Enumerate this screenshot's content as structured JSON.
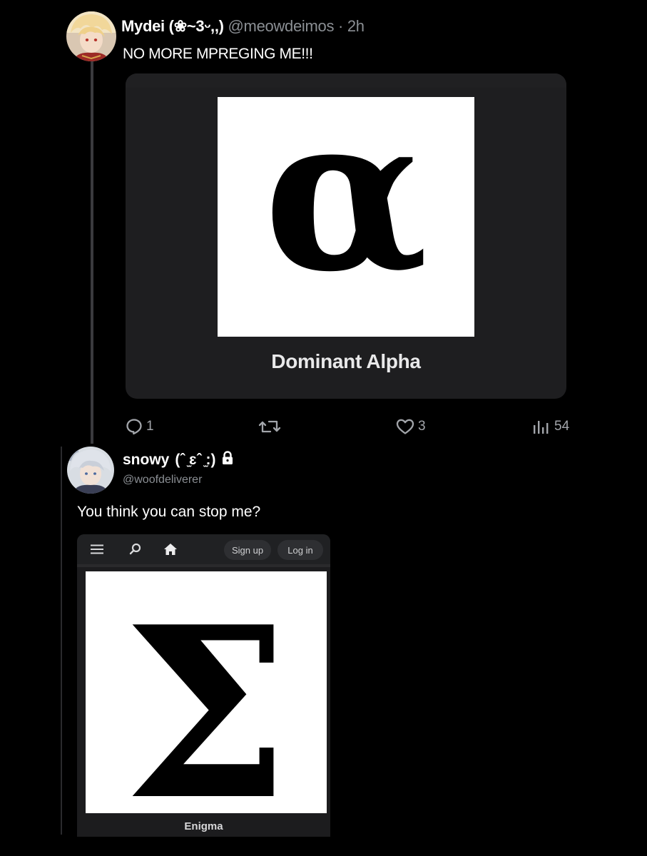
{
  "tweet": {
    "author_name": "Mydei",
    "author_kaomoji": "(❀~3ᵕ,,)",
    "author_handle": "@meowdeimos",
    "separator": "·",
    "time_ago": "2h",
    "text": "NO MORE MPREGING ME!!!",
    "card": {
      "symbol": "α",
      "caption": "Dominant Alpha"
    },
    "actions": {
      "replies": "1",
      "likes": "3",
      "views": "54"
    }
  },
  "reply": {
    "author_name": "snowy",
    "author_kaomoji": "(ˆ ̫ɛˆ ̫:)",
    "author_handle": "@woofdeliverer",
    "text": "You think you can stop me?",
    "card": {
      "nav": {
        "signup_label": "Sign up",
        "login_label": "Log in"
      },
      "symbol": "Σ",
      "caption": "Enigma"
    }
  },
  "icons": {
    "reply": "speech-bubble-icon",
    "retweet": "retweet-icon",
    "like": "heart-icon",
    "views": "bar-chart-icon",
    "lock": "lock-icon",
    "menu": "hamburger-menu-icon",
    "search": "search-icon",
    "home": "home-icon"
  },
  "colors": {
    "background": "#000000",
    "card_background": "#1e1e20",
    "muted_text": "#8b8f94",
    "thread_line": "#3a3a3e"
  }
}
